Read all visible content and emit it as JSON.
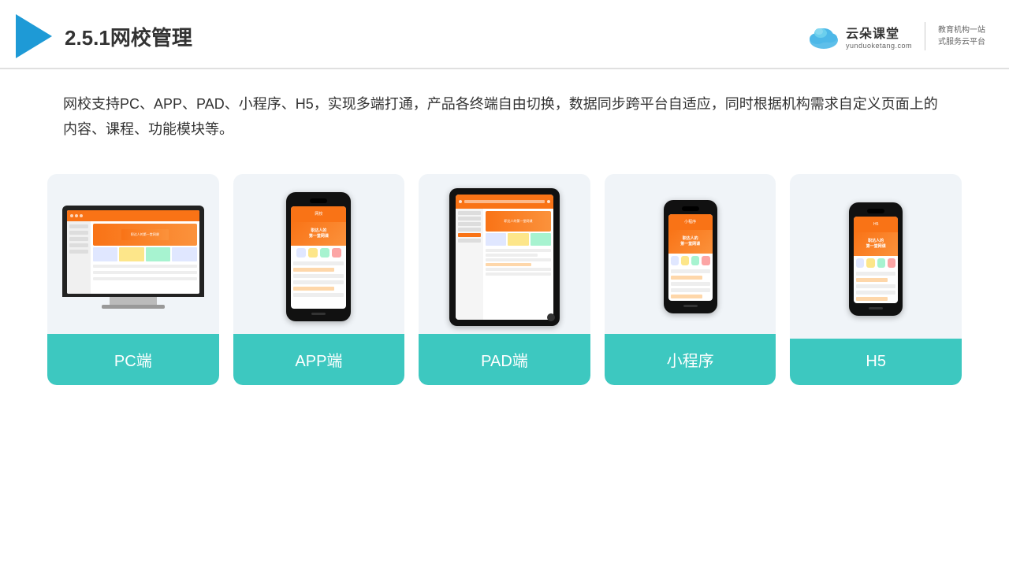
{
  "header": {
    "title": "2.5.1网校管理",
    "logo_name": "云朵课堂",
    "logo_sub": "yunduoketang.com",
    "logo_right_line1": "教育机构一站",
    "logo_right_line2": "式服务云平台"
  },
  "description": {
    "text": "网校支持PC、APP、PAD、小程序、H5，实现多端打通，产品各终端自由切换，数据同步跨平台自适应，同时根据机构需求自定义页面上的内容、课程、功能模块等。"
  },
  "cards": [
    {
      "label": "PC端",
      "type": "pc"
    },
    {
      "label": "APP端",
      "type": "phone"
    },
    {
      "label": "PAD端",
      "type": "tablet"
    },
    {
      "label": "小程序",
      "type": "phone-mini"
    },
    {
      "label": "H5",
      "type": "phone-mini2"
    }
  ],
  "colors": {
    "accent": "#3dc8c0",
    "header_line": "#d0d0d0",
    "triangle": "#1e9ad6"
  }
}
